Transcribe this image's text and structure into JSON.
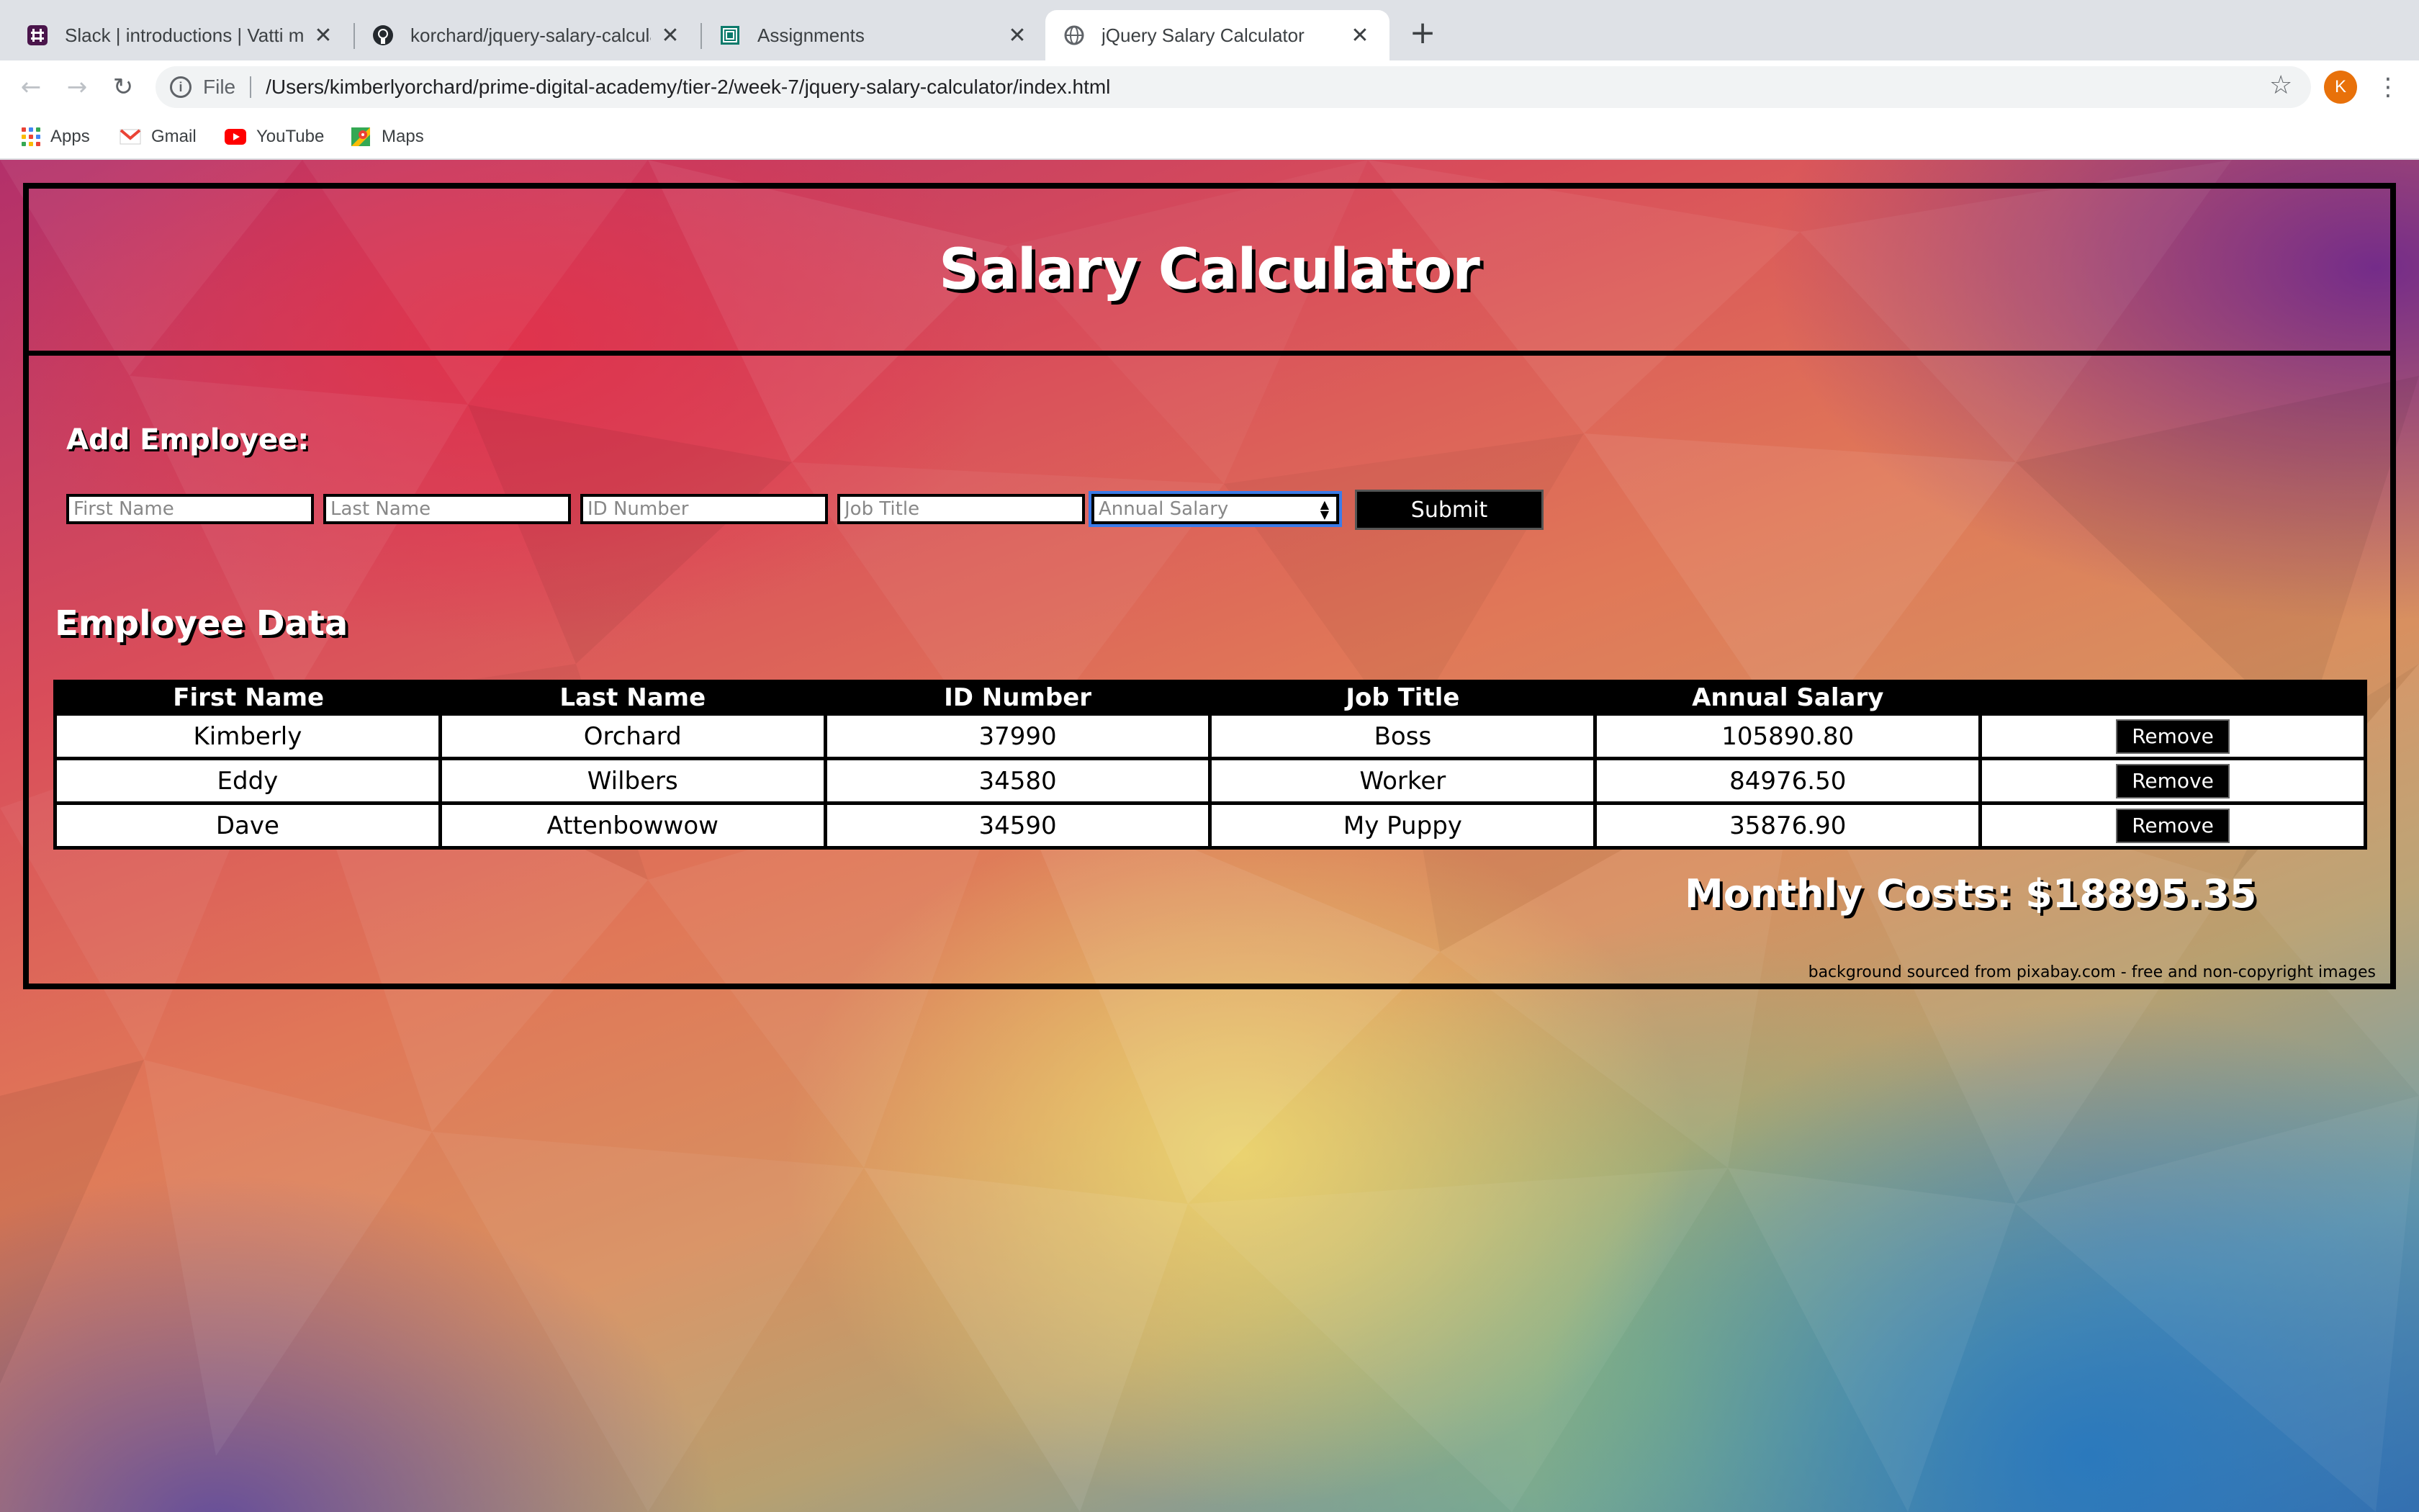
{
  "browser": {
    "tabs": [
      {
        "title": "Slack | introductions | Vatti me",
        "icon": "slack-icon",
        "active": false
      },
      {
        "title": "korchard/jquery-salary-calcula",
        "icon": "github-icon",
        "active": false
      },
      {
        "title": "Assignments",
        "icon": "assignments-icon",
        "active": false
      },
      {
        "title": "jQuery Salary Calculator",
        "icon": "globe-icon",
        "active": true
      }
    ],
    "tab_close_glyph": "✕",
    "new_tab_glyph": "+",
    "address": {
      "scheme": "File",
      "url": "/Users/kimberlyorchard/prime-digital-academy/tier-2/week-7/jquery-salary-calculator/index.html"
    },
    "profile_initial": "K",
    "bookmarks": [
      {
        "label": "Apps",
        "icon": "apps-grid-icon"
      },
      {
        "label": "Gmail",
        "icon": "gmail-icon"
      },
      {
        "label": "YouTube",
        "icon": "youtube-icon"
      },
      {
        "label": "Maps",
        "icon": "maps-icon"
      }
    ]
  },
  "page": {
    "title": "Salary Calculator",
    "add_heading": "Add Employee:",
    "form": {
      "first_name_placeholder": "First Name",
      "last_name_placeholder": "Last Name",
      "id_placeholder": "ID Number",
      "job_title_placeholder": "Job Title",
      "salary_placeholder": "Annual Salary",
      "submit_label": "Submit"
    },
    "data_heading": "Employee Data",
    "table": {
      "headers": [
        "First Name",
        "Last Name",
        "ID Number",
        "Job Title",
        "Annual Salary",
        ""
      ],
      "rows": [
        {
          "first": "Kimberly",
          "last": "Orchard",
          "id": "37990",
          "title": "Boss",
          "salary": "105890.80",
          "action": "Remove"
        },
        {
          "first": "Eddy",
          "last": "Wilbers",
          "id": "34580",
          "title": "Worker",
          "salary": "84976.50",
          "action": "Remove"
        },
        {
          "first": "Dave",
          "last": "Attenbowwow",
          "id": "34590",
          "title": "My Puppy",
          "salary": "35876.90",
          "action": "Remove"
        }
      ]
    },
    "monthly_costs": "Monthly Costs: $18895.35",
    "credit": "background sourced from pixabay.com - free and non-copyright images"
  }
}
